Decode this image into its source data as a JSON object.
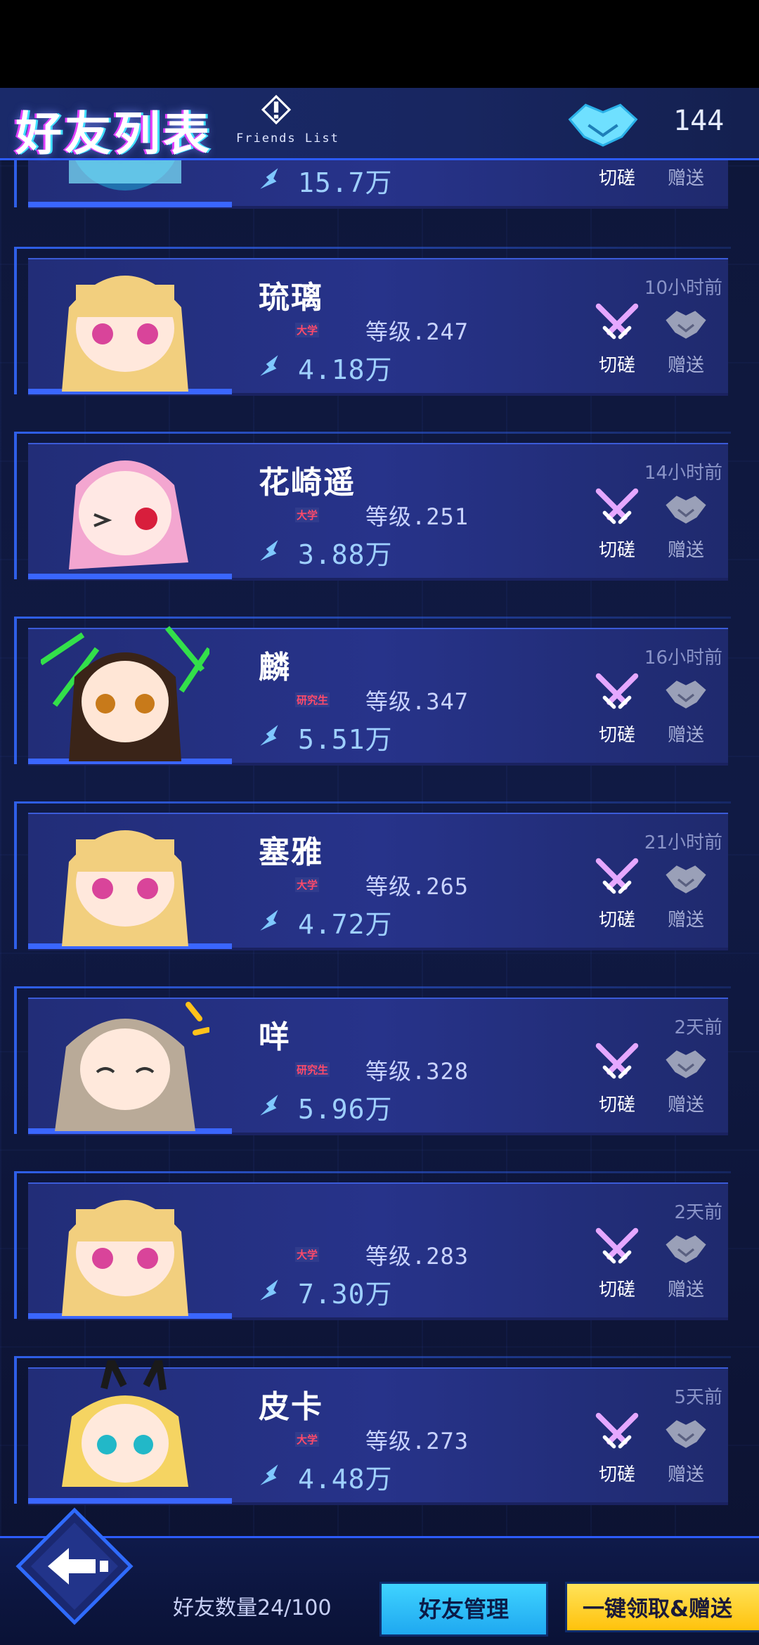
{
  "header": {
    "title": "好友列表",
    "subtitle": "Friends List",
    "friend_count": "144"
  },
  "actions": {
    "spar_label": "切磋",
    "gift_label": "赠送"
  },
  "friends": [
    {
      "name": "",
      "badge": "",
      "level": "",
      "power": "15.7万",
      "last_seen": ""
    },
    {
      "name": "琉璃",
      "badge": "大学",
      "level": "等级.247",
      "power": "4.18万",
      "last_seen": "10小时前"
    },
    {
      "name": "花崎遥",
      "badge": "大学",
      "level": "等级.251",
      "power": "3.88万",
      "last_seen": "14小时前"
    },
    {
      "name": "麟",
      "badge": "研究生",
      "level": "等级.347",
      "power": "5.51万",
      "last_seen": "16小时前"
    },
    {
      "name": "塞雅",
      "badge": "大学",
      "level": "等级.265",
      "power": "4.72万",
      "last_seen": "21小时前"
    },
    {
      "name": "咩",
      "badge": "研究生",
      "level": "等级.328",
      "power": "5.96万",
      "last_seen": "2天前"
    },
    {
      "name": "",
      "badge": "大学",
      "level": "等级.283",
      "power": "7.30万",
      "last_seen": "2天前"
    },
    {
      "name": "皮卡",
      "badge": "大学",
      "level": "等级.273",
      "power": "4.48万",
      "last_seen": "5天前"
    }
  ],
  "footer": {
    "friend_quota": "好友数量24/100",
    "manage_label": "好友管理",
    "claim_all_label": "一键领取&赠送"
  },
  "colors": {
    "accent": "#2c5cff",
    "card": "#27338a",
    "manage_button": "#3fd3ff",
    "claim_button": "#ffc20c"
  }
}
